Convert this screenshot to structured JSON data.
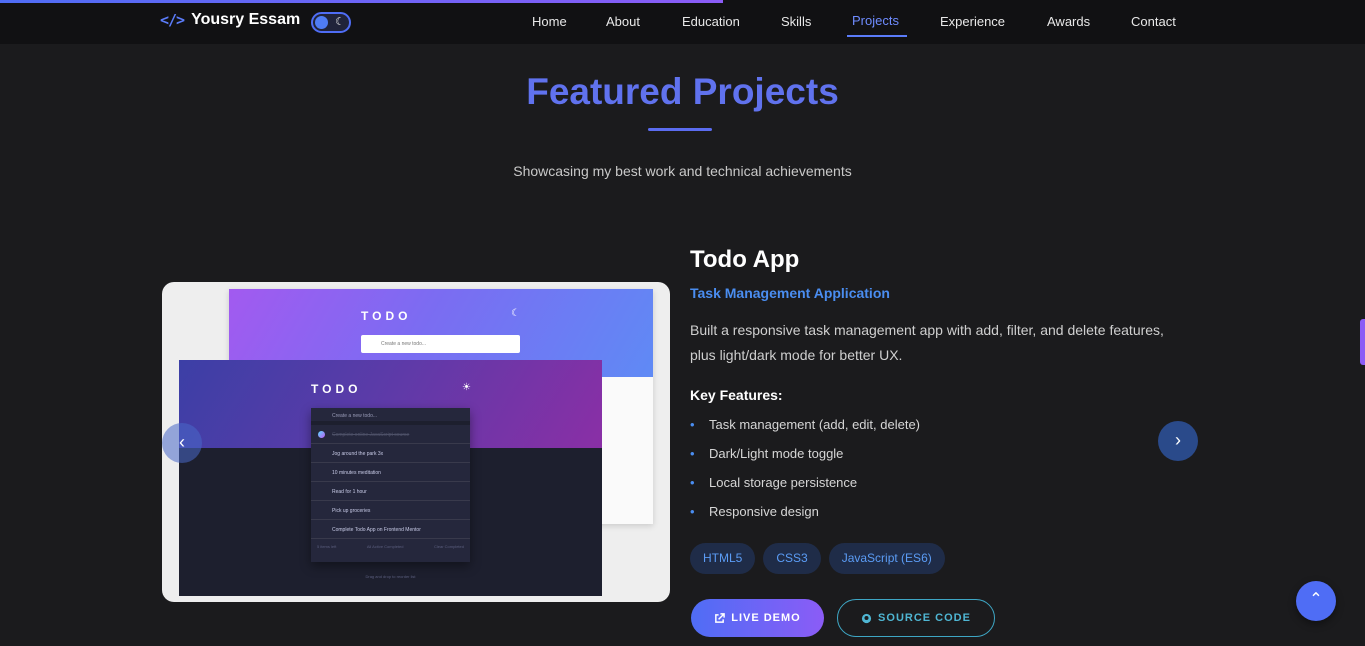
{
  "header": {
    "brand_icon": "</>",
    "brand_name": "Yousry Essam",
    "nav": [
      {
        "label": "Home"
      },
      {
        "label": "About"
      },
      {
        "label": "Education"
      },
      {
        "label": "Skills"
      },
      {
        "label": "Projects",
        "active": true
      },
      {
        "label": "Experience"
      },
      {
        "label": "Awards"
      },
      {
        "label": "Contact"
      }
    ],
    "theme_icon": "☾"
  },
  "section": {
    "title": "Featured Projects",
    "subtitle": "Showcasing my best work and technical achievements"
  },
  "preview": {
    "light_title": "TODO",
    "light_input": "Create a new todo...",
    "dark_title": "TODO",
    "dark_input": "Create a new todo...",
    "todos": [
      "Complete online JavaScript course",
      "Jog around the park 3x",
      "10 minutes meditation",
      "Read for 1 hour",
      "Pick up groceries",
      "Complete Todo App on Frontend Mentor"
    ],
    "footer_left": "5 items left",
    "footer_filters": "All   Active   Completed",
    "footer_clear": "Clear Completed",
    "hint": "Drag and drop to reorder list"
  },
  "project": {
    "title": "Todo App",
    "subtitle": "Task Management Application",
    "description": "Built a responsive task management app with add, filter, and delete features, plus light/dark mode for better UX.",
    "features_title": "Key Features:",
    "features": [
      "Task management (add, edit, delete)",
      "Dark/Light mode toggle",
      "Local storage persistence",
      "Responsive design"
    ],
    "tags": [
      "HTML5",
      "CSS3",
      "JavaScript (ES6)"
    ],
    "demo_label": "LIVE DEMO",
    "source_label": "SOURCE CODE"
  },
  "controls": {
    "prev_icon": "‹",
    "next_icon": "›",
    "top_icon": "⌃"
  },
  "colors": {
    "accent": "#5b7cfa",
    "background": "#1b1b1d",
    "navbar": "#111113",
    "link_blue": "#4a8df0"
  }
}
